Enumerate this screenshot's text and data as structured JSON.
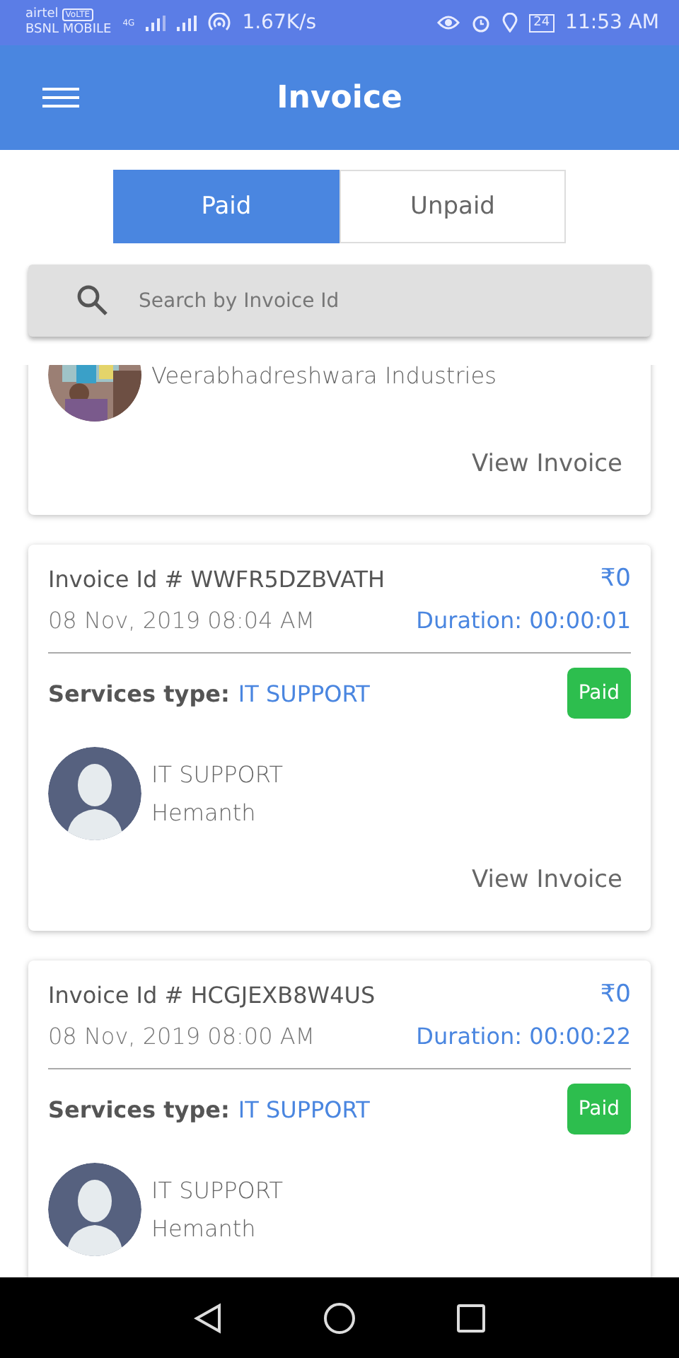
{
  "status_bar": {
    "carrier_1": "airtel",
    "volte_badge": "VoLTE",
    "carrier_2": "BSNL MOBILE",
    "network": "4G",
    "speed": "1.67K/s",
    "battery": "24",
    "time": "11:53 AM"
  },
  "app_bar": {
    "title": "Invoice"
  },
  "tabs": [
    {
      "label": "Paid",
      "selected": true
    },
    {
      "label": "Unpaid",
      "selected": false
    }
  ],
  "search": {
    "placeholder": "Search by Invoice Id"
  },
  "invoices": [
    {
      "partial": true,
      "line_1": "Veerabhadreshwara Industries",
      "link": "View Invoice"
    },
    {
      "partial": false,
      "invoice_id": "Invoice Id # WWFR5DZBVATH",
      "amount": "₹0",
      "date": "08 Nov, 2019 08:04 AM",
      "duration": "Duration: 00:00:01",
      "services_label": "Services type:",
      "service": "IT SUPPORT",
      "status": {
        "label": "Paid",
        "color": "#2dbe4e"
      },
      "avatar": {
        "kind": "placeholder"
      },
      "line_1": "IT SUPPORT",
      "line_2": "Hemanth",
      "link": "View Invoice"
    },
    {
      "partial": false,
      "invoice_id": "Invoice Id # HCGJEXB8W4US",
      "amount": "₹0",
      "date": "08 Nov, 2019 08:00 AM",
      "duration": "Duration: 00:00:22",
      "services_label": "Services type:",
      "service": "IT SUPPORT",
      "status": {
        "label": "Paid",
        "color": "#2dbe4e"
      },
      "avatar": {
        "kind": "placeholder"
      },
      "line_1": "IT SUPPORT",
      "line_2": "Hemanth"
    }
  ]
}
